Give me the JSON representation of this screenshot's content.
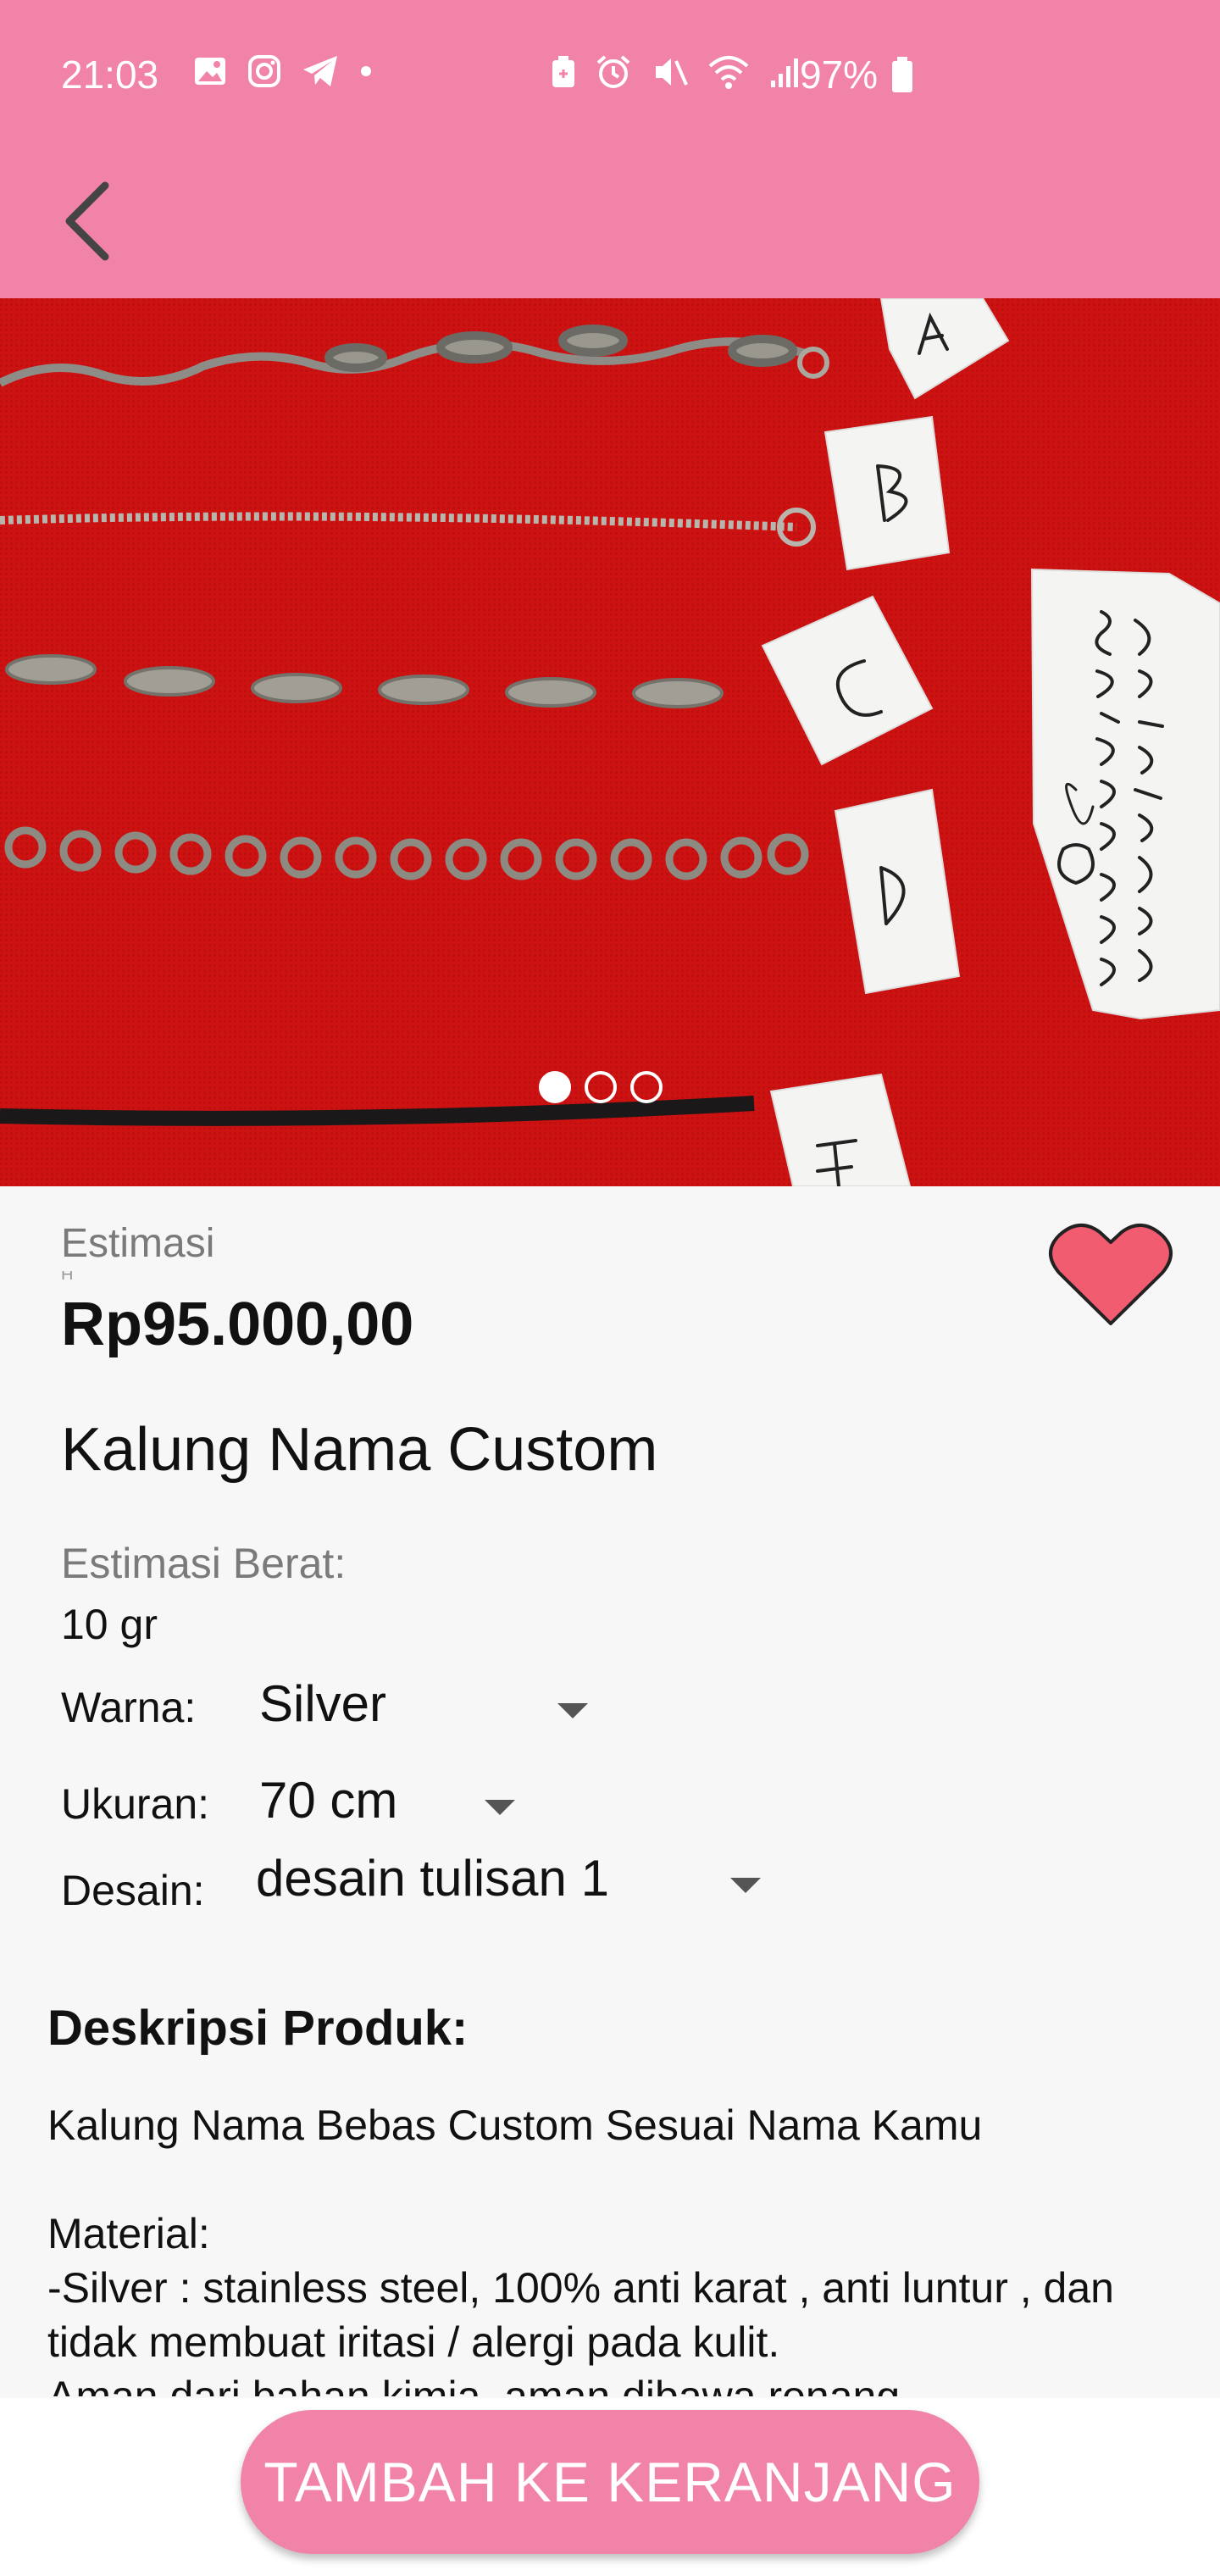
{
  "status_bar": {
    "time": "21:03",
    "battery_percent": "97%",
    "left_icons": [
      "gallery-icon",
      "instagram-icon",
      "telegram-icon",
      "notification-dot-icon"
    ],
    "right_icons": [
      "battery-saver-icon",
      "alarm-icon",
      "mute-icon",
      "wifi-icon",
      "signal-icon",
      "battery-icon"
    ]
  },
  "app_bar": {
    "back_icon": "back-arrow-icon"
  },
  "carousel": {
    "slides": 3,
    "active_index": 0,
    "card_letters": [
      "A",
      "B",
      "C",
      "D",
      "E"
    ],
    "card_handwriting": "customyourname .id"
  },
  "product": {
    "price_label": "Estimasi",
    "price_label_cutoff": "H",
    "price": "Rp95.000,00",
    "title": "Kalung Nama Custom",
    "weight_label": "Estimasi Berat:",
    "weight_value": "10 gr"
  },
  "options": {
    "color_label": "Warna:",
    "color_value": "Silver",
    "size_label": "Ukuran:",
    "size_value": "70 cm",
    "design_label": "Desain:",
    "design_value": "desain tulisan 1"
  },
  "description": {
    "heading": "Deskripsi Produk:",
    "line1": "Kalung Nama Bebas Custom Sesuai Nama Kamu",
    "line2": "Material:",
    "line3": "-Silver : stainless steel, 100% anti karat , anti luntur , dan",
    "line4": "tidak membuat iritasi / alergi pada kulit.",
    "line5": "Aman dari bahan kimia, aman dibawa renang"
  },
  "actions": {
    "add_to_cart": "TAMBAH KE KERANJANG"
  },
  "colors": {
    "accent": "#f283a8",
    "photo_background": "#cf1414",
    "favorite": "#f25c70"
  }
}
